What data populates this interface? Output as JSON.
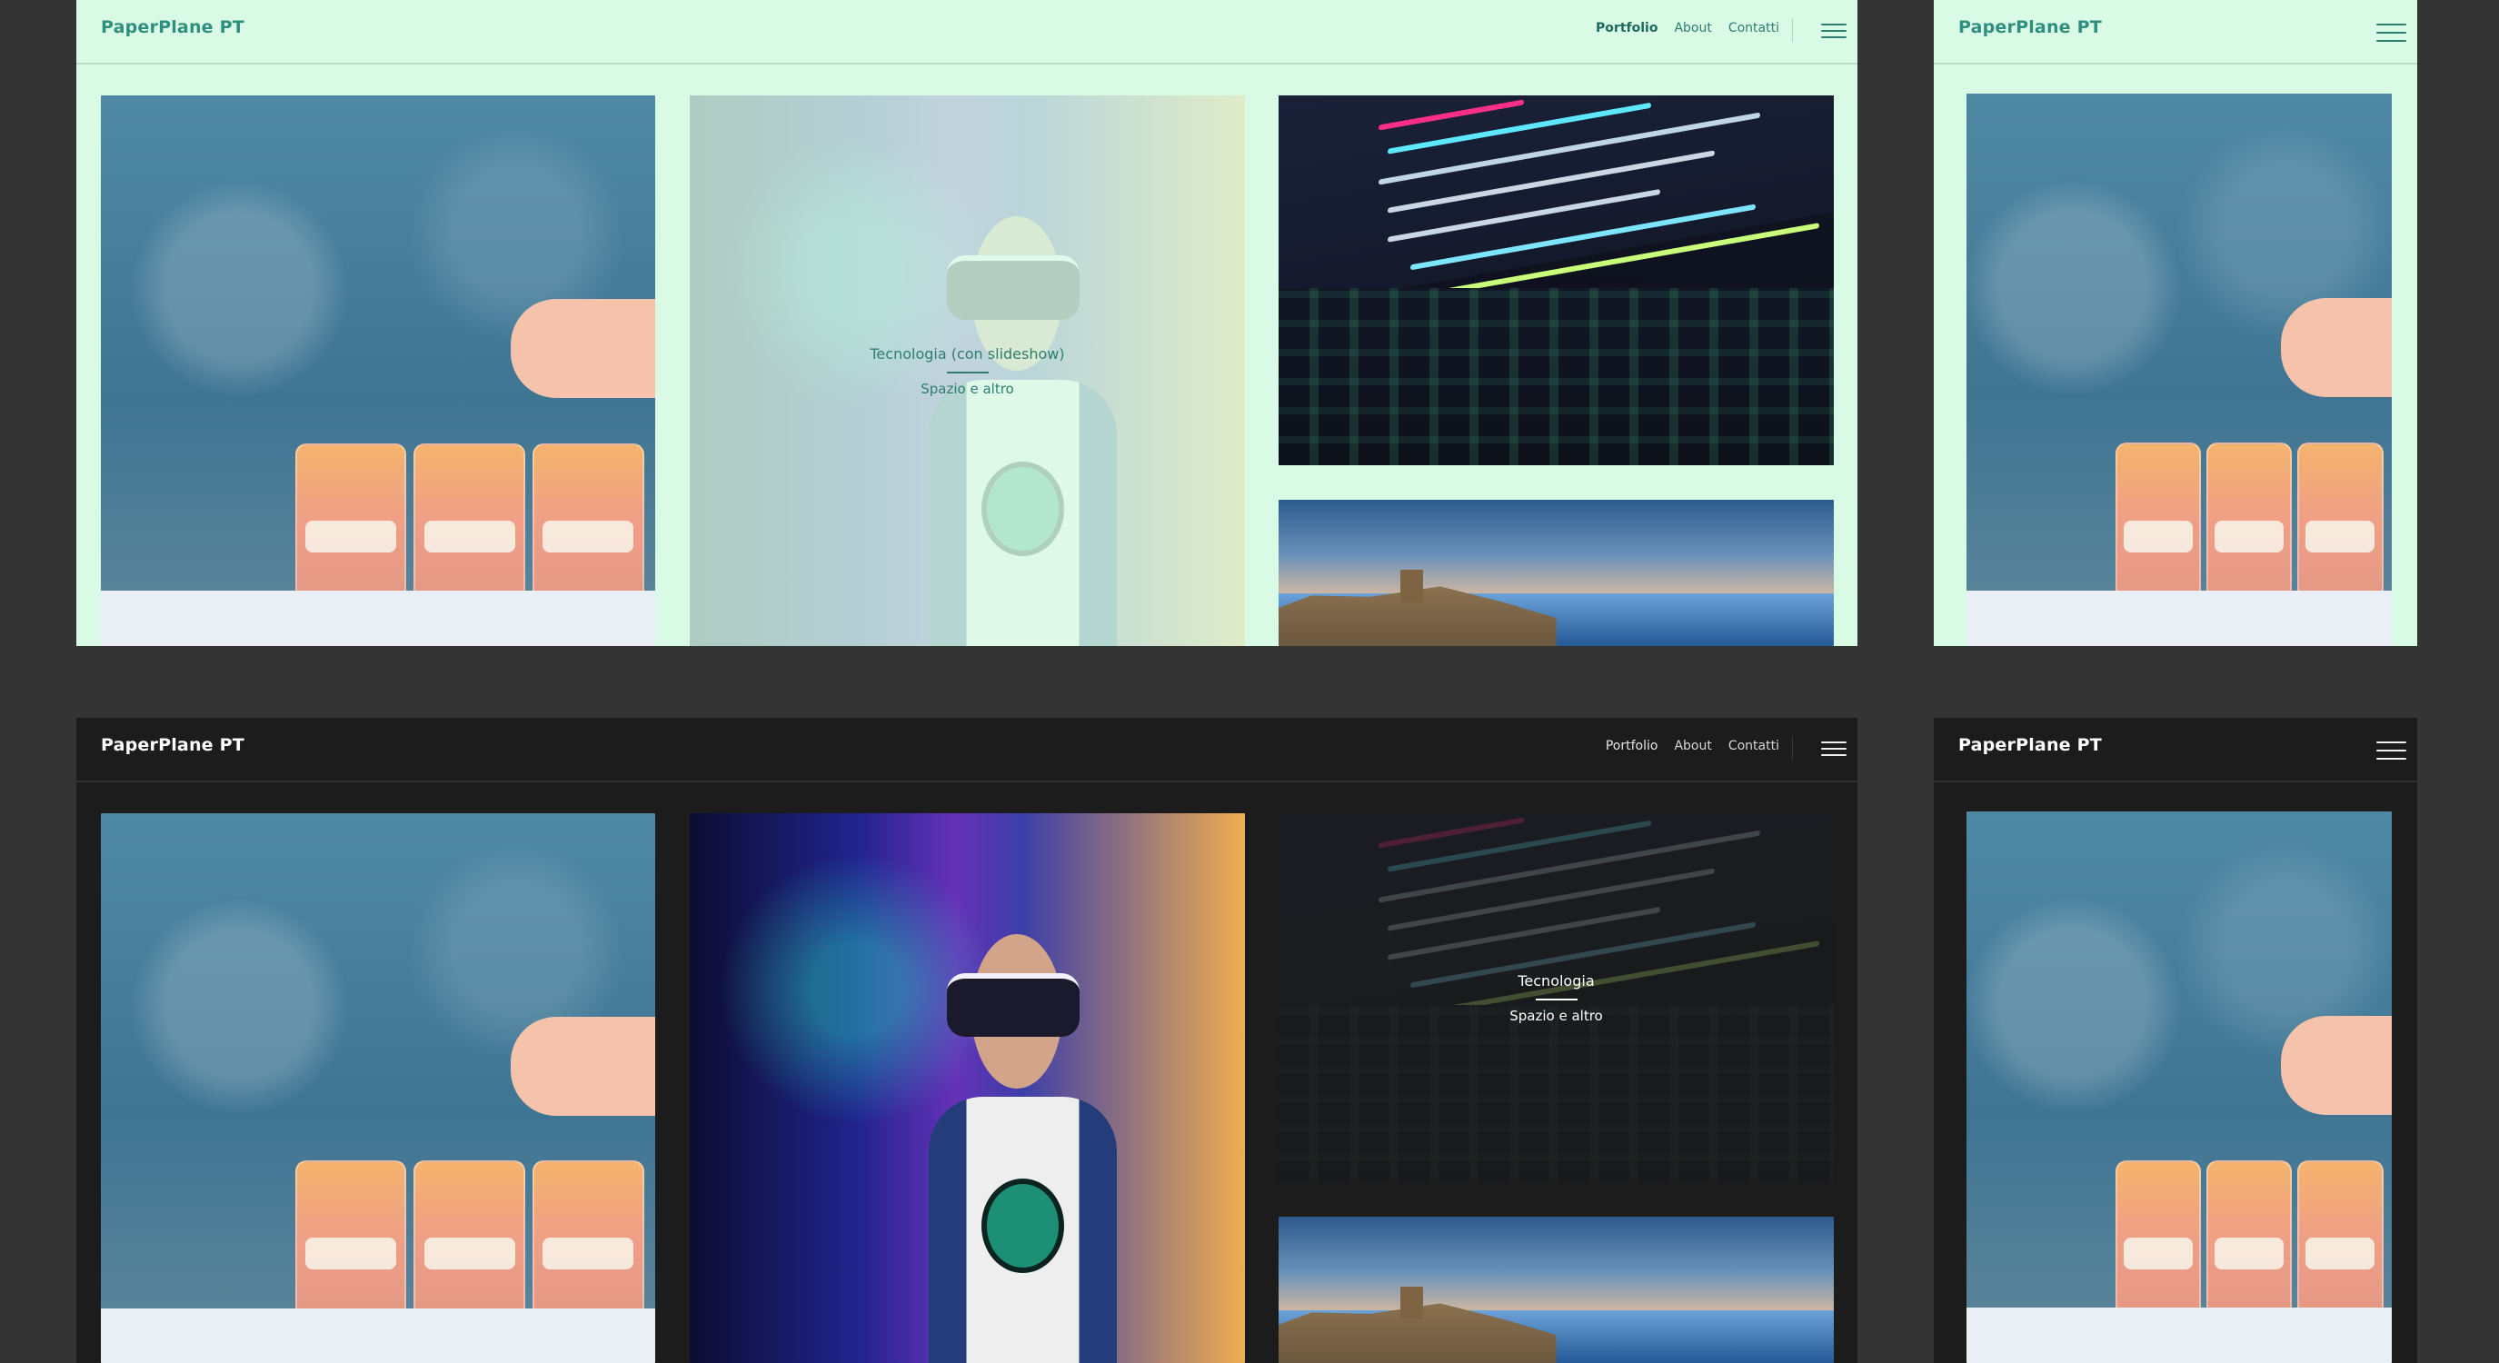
{
  "brand": "PaperPlane PT",
  "nav": [
    "Portfolio",
    "About",
    "Contatti"
  ],
  "overlays": {
    "light_tile": {
      "title": "Tecnologia (con slideshow)",
      "subtitle": "Spazio e altro"
    },
    "dark_tile": {
      "title": "Tecnologia",
      "subtitle": "Spazio e altro"
    }
  }
}
